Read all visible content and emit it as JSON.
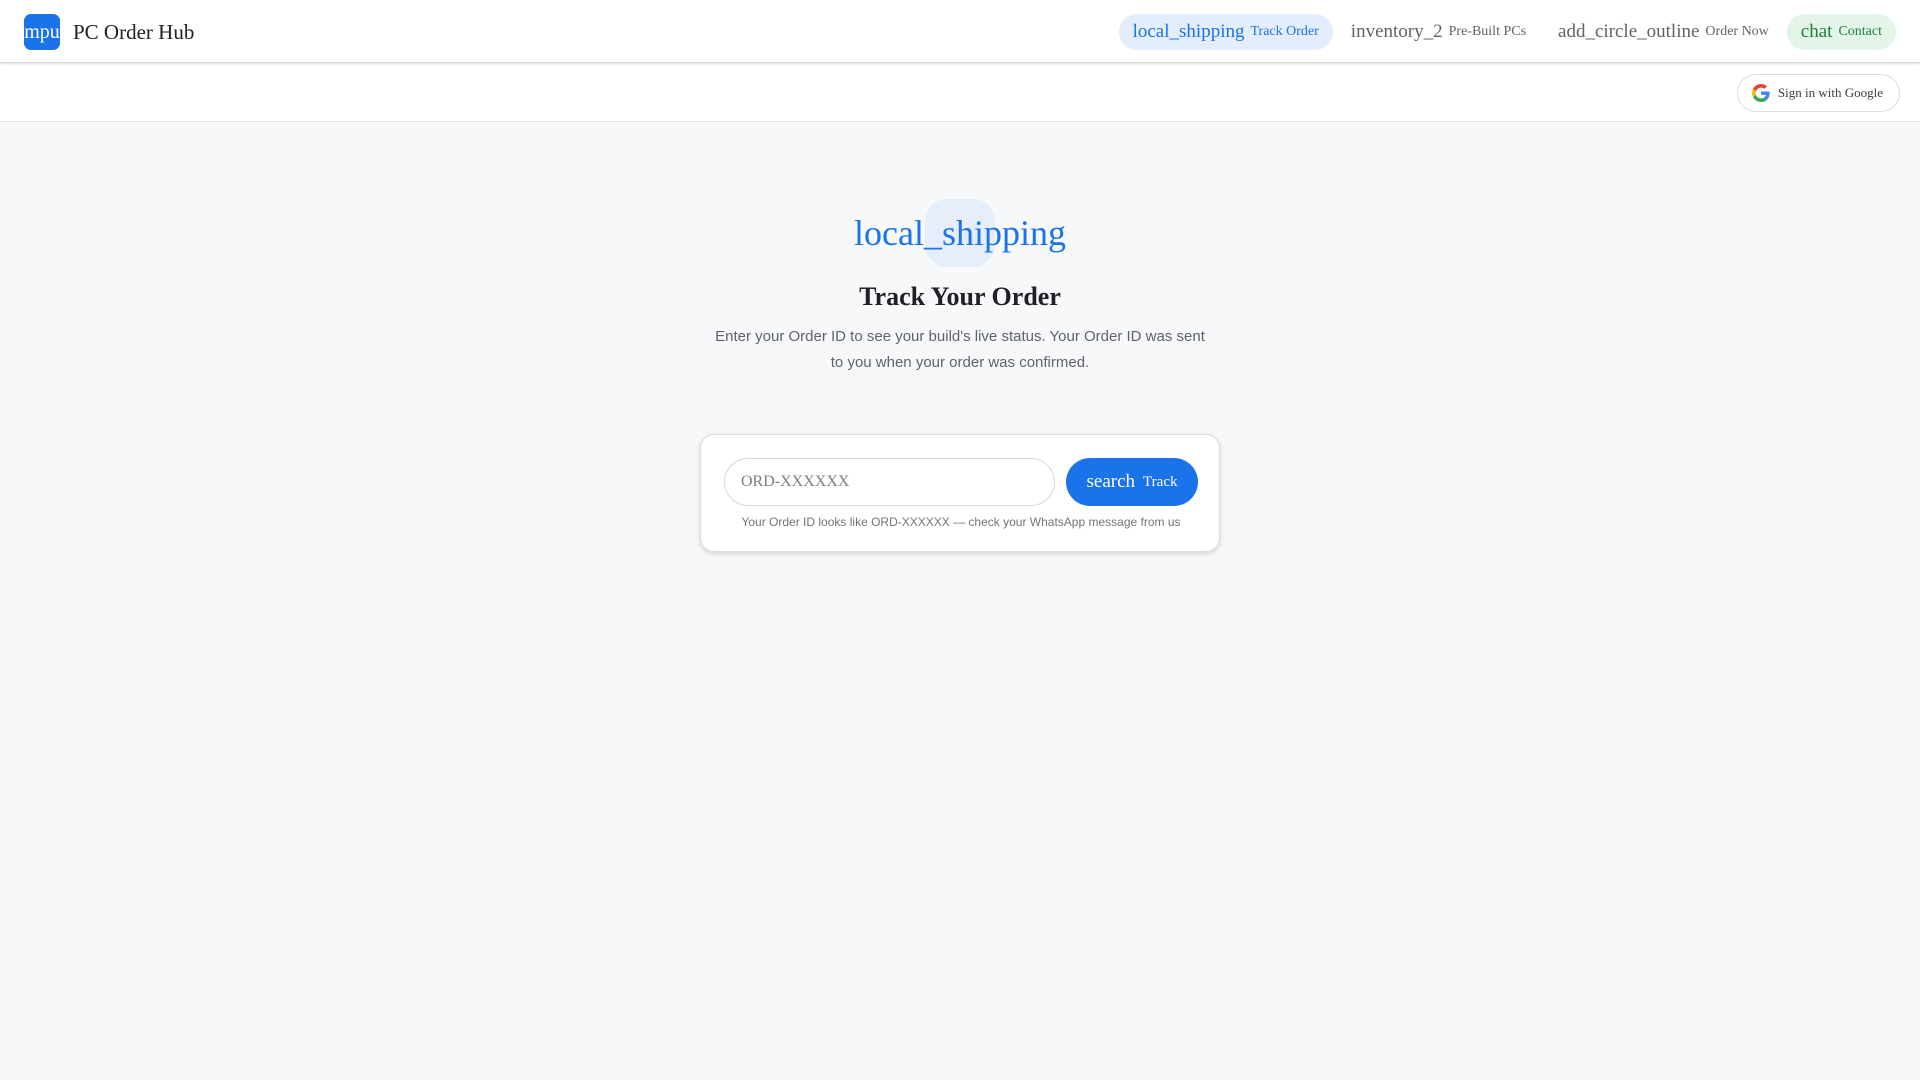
{
  "brand": {
    "logo_text": "mpu",
    "name": "PC Order Hub",
    "color": "#1a73e8"
  },
  "nav": {
    "items": [
      {
        "icon": "local_shipping",
        "label": "Track Order",
        "state": "active"
      },
      {
        "icon": "inventory_2",
        "label": "Pre-Built PCs",
        "state": "default"
      },
      {
        "icon": "add_circle_outline",
        "label": "Order Now",
        "state": "default"
      },
      {
        "icon": "chat",
        "label": "Contact",
        "state": "accent-green"
      }
    ]
  },
  "auth": {
    "google_signin_label": "Sign in with Google"
  },
  "hero": {
    "icon": "local_shipping",
    "title": "Track Your Order",
    "subtitle": "Enter your Order ID to see your build's live status. Your Order ID was sent to you when your order was confirmed."
  },
  "track_form": {
    "input_value": "",
    "input_placeholder": "ORD-XXXXXX",
    "button_icon": "search",
    "button_label": "Track",
    "hint": "Your Order ID looks like ORD-XXXXXX — check your WhatsApp message from us"
  },
  "colors": {
    "accent": "#1a73e8",
    "active_nav_bg": "#e4edfb",
    "contact_bg": "#e3f4e8",
    "contact_fg": "#1e7f3c",
    "page_bg": "#f7f8fa"
  }
}
